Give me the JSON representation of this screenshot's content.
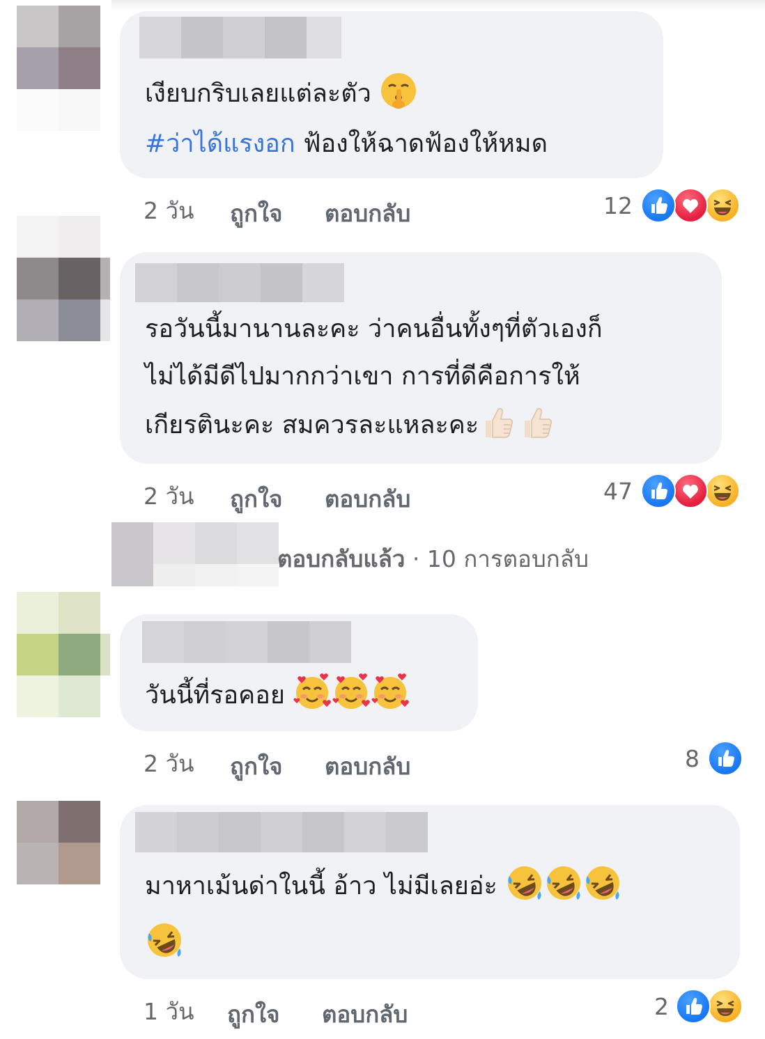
{
  "comments": [
    {
      "lines": [
        {
          "parts": [
            {
              "text": "เงียบกริบเลยแต่ละตัว ",
              "tag": false
            }
          ],
          "emojis": [
            "shushing"
          ]
        },
        {
          "parts": [
            {
              "text": "#ว่าได้แรงอก",
              "tag": true
            },
            {
              "text": " ฟ้องให้ฉาดฟ้องให้หมด",
              "tag": false
            }
          ],
          "emojis": []
        }
      ],
      "time": "2 วัน",
      "like_label": "ถูกใจ",
      "reply_label": "ตอบกลับ",
      "reaction_count": "12",
      "reactions": [
        "like-icon",
        "love-icon",
        "haha-icon"
      ]
    },
    {
      "lines": [
        {
          "parts": [
            {
              "text": "รอวันนี้มานานละคะ ว่าคนอื่นทั้งๆที่ตัวเองก็",
              "tag": false
            }
          ],
          "emojis": []
        },
        {
          "parts": [
            {
              "text": "ไม่ได้มีดีไปมากกว่าเขา การที่ดีคือการให้",
              "tag": false
            }
          ],
          "emojis": []
        },
        {
          "parts": [
            {
              "text": "เกียรตินะคะ สมควรละแหละคะ",
              "tag": false
            }
          ],
          "emojis": [
            "thumbs-up",
            "thumbs-up"
          ]
        }
      ],
      "time": "2 วัน",
      "like_label": "ถูกใจ",
      "reply_label": "ตอบกลับ",
      "reaction_count": "47",
      "reactions": [
        "like-icon",
        "love-icon",
        "haha-icon"
      ]
    },
    {
      "lines": [
        {
          "parts": [
            {
              "text": "วันนี้ที่รอคอย ",
              "tag": false
            }
          ],
          "emojis": [
            "smiling-hearts",
            "smiling-hearts",
            "smiling-hearts"
          ]
        }
      ],
      "time": "2 วัน",
      "like_label": "ถูกใจ",
      "reply_label": "ตอบกลับ",
      "reaction_count": "8",
      "reactions": [
        "like-icon"
      ]
    },
    {
      "lines": [
        {
          "parts": [
            {
              "text": "มาหาเม้นด่าในนี้ อ้าว ไม่มีเลยอ่ะ  ",
              "tag": false
            }
          ],
          "emojis": [
            "rofl",
            "rofl",
            "rofl"
          ]
        },
        {
          "parts": [],
          "emojis": [
            "rofl"
          ]
        }
      ],
      "time": "1 วัน",
      "like_label": "ถูกใจ",
      "reply_label": "ตอบกลับ",
      "reaction_count": "2",
      "reactions": [
        "like-icon",
        "haha-icon"
      ]
    }
  ],
  "replies_row": {
    "replied_label": "ตอบกลับแล้ว",
    "separator": " · ",
    "replies_count": "10 การตอบกลับ"
  },
  "colors": {
    "bubble": "#f0f2f5",
    "hashtag": "#3b74d8",
    "meta": "#65676b",
    "like": "#1877f2",
    "love": "#e41e3f",
    "haha": "#f7b125"
  }
}
